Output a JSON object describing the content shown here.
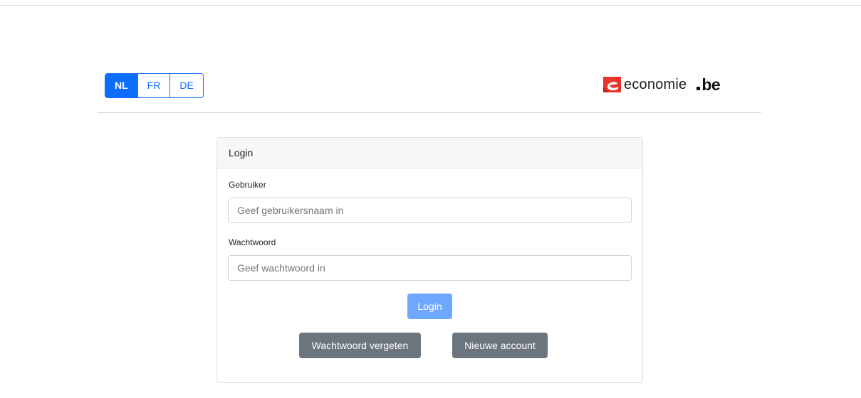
{
  "languages": [
    {
      "label": "NL",
      "active": true
    },
    {
      "label": "FR",
      "active": false
    },
    {
      "label": "DE",
      "active": false
    }
  ],
  "brand": {
    "word": "economie",
    "tld": "be",
    "logo_icon": "economie-e-logo-icon",
    "logo_color": "#e8342d"
  },
  "card": {
    "header": "Login",
    "username": {
      "label": "Gebruiker",
      "placeholder": "Geef gebruikersnaam in",
      "value": ""
    },
    "password": {
      "label": "Wachtwoord",
      "placeholder": "Geef wachtwoord in",
      "value": ""
    },
    "login_button": "Login",
    "forgot_button": "Wachtwoord vergeten",
    "new_account_button": "Nieuwe account"
  },
  "colors": {
    "primary": "#0d6efd",
    "primary_disabled": "#6ea8fe",
    "secondary": "#6c757d"
  }
}
